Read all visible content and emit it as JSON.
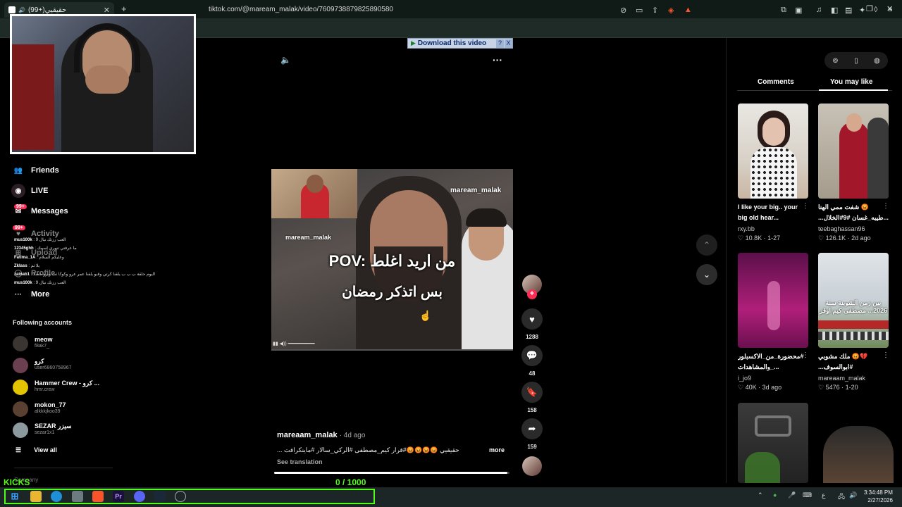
{
  "browser": {
    "tab_title": "(99+)حقيقيي",
    "new_tab": "+",
    "tab_close": "✕",
    "url": "tiktok.com/@maream_malak/video/7609738879825890580",
    "minimize": "–",
    "restore": "❐",
    "close": "✕"
  },
  "download_bar": {
    "label": "Download this video",
    "help": "?",
    "close": "X"
  },
  "sidebar": {
    "nav": [
      {
        "label": "Friends"
      },
      {
        "label": "LIVE"
      },
      {
        "label": "Messages",
        "badge": "99+"
      },
      {
        "label": "Activity",
        "badge": "99+"
      },
      {
        "label": "Upload"
      },
      {
        "label": "Profile"
      },
      {
        "label": "More"
      }
    ],
    "chat_lines": [
      {
        "user": "mus100k",
        "text": ": العب رزتك نيال 9"
      },
      {
        "user": "12345ghh",
        "text": ": ما عرفتي تنوري إسمك"
      },
      {
        "user": "Fatima_1A",
        "text": ": وعليكم السلام"
      },
      {
        "user": "Zklass",
        "text": ": يلا ثم"
      },
      {
        "user": "zainab1",
        "text": ": اليوم حلقة ب ب ب يلقنا كرتي وقبو يلقنا عمر عرو وكوكا ثث ويرو حصلا"
      },
      {
        "user": "mus100k",
        "text": ": العب رزتك نيال 9"
      }
    ],
    "following_title": "Following accounts",
    "accounts": [
      {
        "name": "meow",
        "handle": "f8ak7_"
      },
      {
        "name": "كرو",
        "handle": "user6860758967"
      },
      {
        "name": "Hammer Crew - كرو ...",
        "handle": "hmr.crew"
      },
      {
        "name": "mokon_77",
        "handle": "alkkkjkoo39"
      },
      {
        "name": "SEZAR سيزر",
        "handle": "sezar1x1"
      }
    ],
    "view_all": "View all",
    "company": "Company"
  },
  "video": {
    "watermark_top": "maream_malak",
    "watermark_mid": "maream_malak",
    "caption_line1": "POV: من اريد اغلط",
    "caption_line2": "بس اتذكر رمضان",
    "author": "mareaam_malak",
    "age": "· 4d ago",
    "description": "حقيقيي 😡😡😡😡#قرار كيم_مصطفى #الركي_سالار #ماينكرافت ...",
    "more": "more",
    "see_translation": "See translation",
    "progress": 0.99
  },
  "actions": {
    "likes": "1288",
    "comments": "48",
    "saves": "158",
    "shares": "159",
    "follow": "+"
  },
  "panel": {
    "tab_comments": "Comments",
    "tab_you_may_like": "You may like",
    "items": [
      {
        "title": "I like your big.. your big old hear...",
        "user": "rxy.bb",
        "likes": "10.8K",
        "date": "1-27"
      },
      {
        "title": "😡 شفت ممي الهنا ...طيبه_غسان #9#الخلال...",
        "user": "teebaghassan96",
        "likes": "126.1K",
        "date": "2d ago"
      },
      {
        "title": "#محضورة_من_الاكسبلور ..._والمشاهدات",
        "user": "i_jo9",
        "likes": "40K",
        "date": "3d ago"
      },
      {
        "title": "💔😡 ملك مشوبي #ابوالسوف...",
        "user": "mareaam_malak",
        "likes": "5476",
        "date": "1-20"
      }
    ],
    "overlay_text": "بين زمن الشوبنة سنة 2026... مصطفى كيم اوقر"
  },
  "overlays": {
    "kicks": "KICKS",
    "counter": "0 / 1000"
  },
  "taskbar": {
    "time": "3:34:48 PM",
    "date": "2/27/2026",
    "lang": "ع"
  },
  "colors": {
    "accent": "#fe2c55",
    "overlay_green": "#53fc18",
    "browser_bg": "#1e2b27"
  }
}
